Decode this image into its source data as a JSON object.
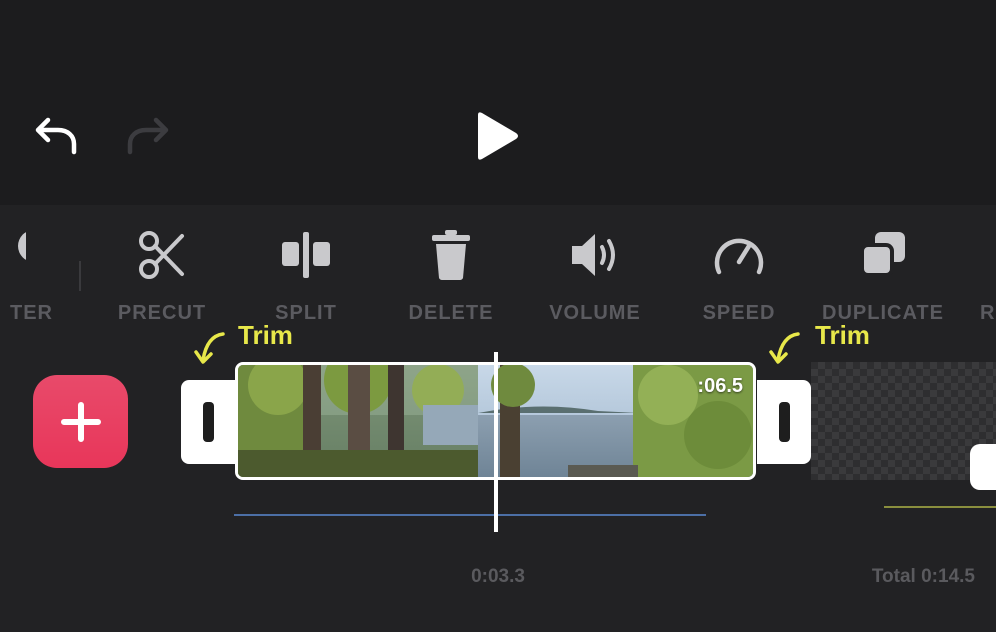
{
  "header": {
    "undo_icon": "undo-icon",
    "redo_icon": "redo-icon",
    "play_icon": "play-icon"
  },
  "toolbar": {
    "items": [
      {
        "id": "filter",
        "label": "TER",
        "icon": "filter-icon"
      },
      {
        "id": "precut",
        "label": "PRECUT",
        "icon": "scissors-icon"
      },
      {
        "id": "split",
        "label": "SPLIT",
        "icon": "split-icon"
      },
      {
        "id": "delete",
        "label": "DELETE",
        "icon": "trash-icon"
      },
      {
        "id": "volume",
        "label": "VOLUME",
        "icon": "volume-icon"
      },
      {
        "id": "speed",
        "label": "SPEED",
        "icon": "speedometer-icon"
      },
      {
        "id": "duplicate",
        "label": "DUPLICATE",
        "icon": "duplicate-icon"
      },
      {
        "id": "r",
        "label": "R",
        "icon": ""
      }
    ]
  },
  "annotations": {
    "trim_left": "Trim",
    "trim_right": "Trim"
  },
  "timeline": {
    "clip_duration": ":06.5",
    "current_time": "0:03.3",
    "total_time": "Total 0:14.5"
  },
  "colors": {
    "background": "#1c1c1e",
    "accent": "#e8365a",
    "annotation": "#e8e84a",
    "audio_track": "#4c6fa6",
    "label_gray": "#5b5b60"
  }
}
